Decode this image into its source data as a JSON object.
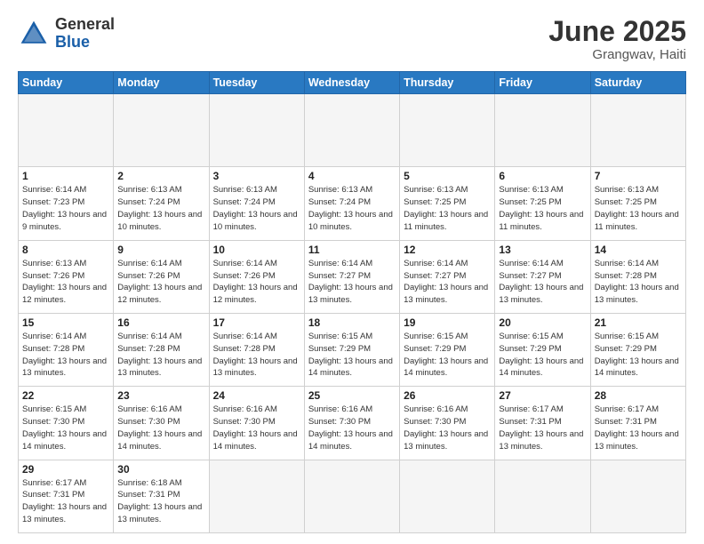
{
  "header": {
    "logo_general": "General",
    "logo_blue": "Blue",
    "month_title": "June 2025",
    "location": "Grangwav, Haiti"
  },
  "calendar": {
    "days_of_week": [
      "Sunday",
      "Monday",
      "Tuesday",
      "Wednesday",
      "Thursday",
      "Friday",
      "Saturday"
    ],
    "weeks": [
      [
        {
          "day": "",
          "empty": true
        },
        {
          "day": "",
          "empty": true
        },
        {
          "day": "",
          "empty": true
        },
        {
          "day": "",
          "empty": true
        },
        {
          "day": "",
          "empty": true
        },
        {
          "day": "",
          "empty": true
        },
        {
          "day": "",
          "empty": true
        }
      ],
      [
        {
          "day": "1",
          "sunrise": "6:14 AM",
          "sunset": "7:23 PM",
          "daylight": "13 hours and 9 minutes."
        },
        {
          "day": "2",
          "sunrise": "6:13 AM",
          "sunset": "7:24 PM",
          "daylight": "13 hours and 10 minutes."
        },
        {
          "day": "3",
          "sunrise": "6:13 AM",
          "sunset": "7:24 PM",
          "daylight": "13 hours and 10 minutes."
        },
        {
          "day": "4",
          "sunrise": "6:13 AM",
          "sunset": "7:24 PM",
          "daylight": "13 hours and 10 minutes."
        },
        {
          "day": "5",
          "sunrise": "6:13 AM",
          "sunset": "7:25 PM",
          "daylight": "13 hours and 11 minutes."
        },
        {
          "day": "6",
          "sunrise": "6:13 AM",
          "sunset": "7:25 PM",
          "daylight": "13 hours and 11 minutes."
        },
        {
          "day": "7",
          "sunrise": "6:13 AM",
          "sunset": "7:25 PM",
          "daylight": "13 hours and 11 minutes."
        }
      ],
      [
        {
          "day": "8",
          "sunrise": "6:13 AM",
          "sunset": "7:26 PM",
          "daylight": "13 hours and 12 minutes."
        },
        {
          "day": "9",
          "sunrise": "6:14 AM",
          "sunset": "7:26 PM",
          "daylight": "13 hours and 12 minutes."
        },
        {
          "day": "10",
          "sunrise": "6:14 AM",
          "sunset": "7:26 PM",
          "daylight": "13 hours and 12 minutes."
        },
        {
          "day": "11",
          "sunrise": "6:14 AM",
          "sunset": "7:27 PM",
          "daylight": "13 hours and 13 minutes."
        },
        {
          "day": "12",
          "sunrise": "6:14 AM",
          "sunset": "7:27 PM",
          "daylight": "13 hours and 13 minutes."
        },
        {
          "day": "13",
          "sunrise": "6:14 AM",
          "sunset": "7:27 PM",
          "daylight": "13 hours and 13 minutes."
        },
        {
          "day": "14",
          "sunrise": "6:14 AM",
          "sunset": "7:28 PM",
          "daylight": "13 hours and 13 minutes."
        }
      ],
      [
        {
          "day": "15",
          "sunrise": "6:14 AM",
          "sunset": "7:28 PM",
          "daylight": "13 hours and 13 minutes."
        },
        {
          "day": "16",
          "sunrise": "6:14 AM",
          "sunset": "7:28 PM",
          "daylight": "13 hours and 13 minutes."
        },
        {
          "day": "17",
          "sunrise": "6:14 AM",
          "sunset": "7:28 PM",
          "daylight": "13 hours and 13 minutes."
        },
        {
          "day": "18",
          "sunrise": "6:15 AM",
          "sunset": "7:29 PM",
          "daylight": "13 hours and 14 minutes."
        },
        {
          "day": "19",
          "sunrise": "6:15 AM",
          "sunset": "7:29 PM",
          "daylight": "13 hours and 14 minutes."
        },
        {
          "day": "20",
          "sunrise": "6:15 AM",
          "sunset": "7:29 PM",
          "daylight": "13 hours and 14 minutes."
        },
        {
          "day": "21",
          "sunrise": "6:15 AM",
          "sunset": "7:29 PM",
          "daylight": "13 hours and 14 minutes."
        }
      ],
      [
        {
          "day": "22",
          "sunrise": "6:15 AM",
          "sunset": "7:30 PM",
          "daylight": "13 hours and 14 minutes."
        },
        {
          "day": "23",
          "sunrise": "6:16 AM",
          "sunset": "7:30 PM",
          "daylight": "13 hours and 14 minutes."
        },
        {
          "day": "24",
          "sunrise": "6:16 AM",
          "sunset": "7:30 PM",
          "daylight": "13 hours and 14 minutes."
        },
        {
          "day": "25",
          "sunrise": "6:16 AM",
          "sunset": "7:30 PM",
          "daylight": "13 hours and 14 minutes."
        },
        {
          "day": "26",
          "sunrise": "6:16 AM",
          "sunset": "7:30 PM",
          "daylight": "13 hours and 13 minutes."
        },
        {
          "day": "27",
          "sunrise": "6:17 AM",
          "sunset": "7:31 PM",
          "daylight": "13 hours and 13 minutes."
        },
        {
          "day": "28",
          "sunrise": "6:17 AM",
          "sunset": "7:31 PM",
          "daylight": "13 hours and 13 minutes."
        }
      ],
      [
        {
          "day": "29",
          "sunrise": "6:17 AM",
          "sunset": "7:31 PM",
          "daylight": "13 hours and 13 minutes."
        },
        {
          "day": "30",
          "sunrise": "6:18 AM",
          "sunset": "7:31 PM",
          "daylight": "13 hours and 13 minutes."
        },
        {
          "day": "",
          "empty": true
        },
        {
          "day": "",
          "empty": true
        },
        {
          "day": "",
          "empty": true
        },
        {
          "day": "",
          "empty": true
        },
        {
          "day": "",
          "empty": true
        }
      ]
    ]
  }
}
